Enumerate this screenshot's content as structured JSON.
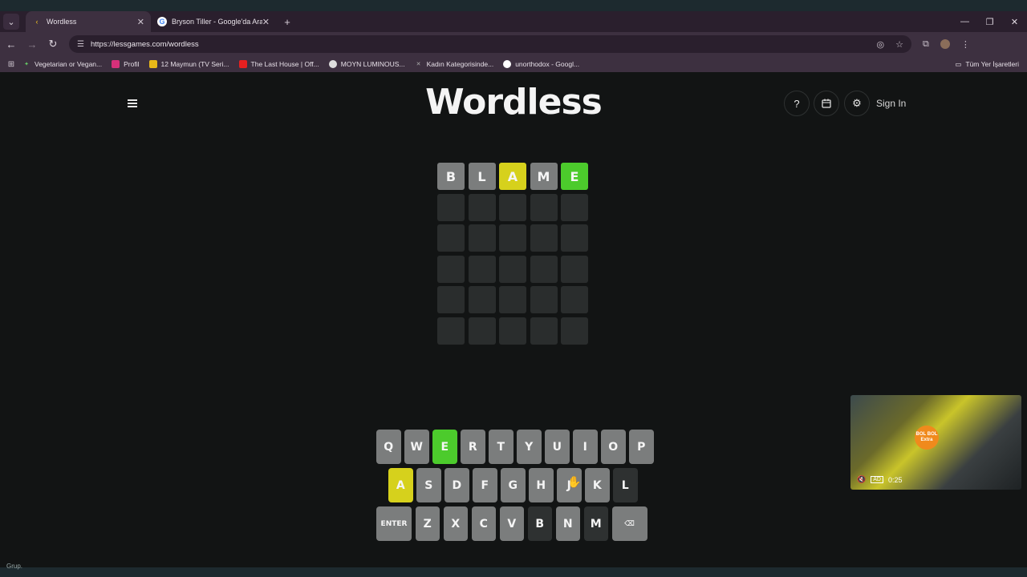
{
  "browser": {
    "tabs": [
      {
        "title": "Wordless",
        "active": true
      },
      {
        "title": "Bryson Tiller - Google'da Ara",
        "active": false
      }
    ],
    "url": "https://lessgames.com/wordless",
    "bookmarks": [
      "Vegetarian or Vegan...",
      "Profil",
      "12 Maymun (TV Seri...",
      "The Last House | Off...",
      "MOYN LUMINOUS...",
      "Kadın Kategorisinde...",
      "unorthodox - Googl..."
    ],
    "bookmarks_folder": "Tüm Yer İşaretleri"
  },
  "app": {
    "logo": "Wordless",
    "help_icon": "?",
    "sign_in": "Sign In"
  },
  "board": {
    "rows": [
      [
        {
          "l": "B",
          "s": "absent"
        },
        {
          "l": "L",
          "s": "absent"
        },
        {
          "l": "A",
          "s": "present"
        },
        {
          "l": "M",
          "s": "absent"
        },
        {
          "l": "E",
          "s": "correct"
        }
      ],
      [
        {
          "l": "",
          "s": "empty"
        },
        {
          "l": "",
          "s": "empty"
        },
        {
          "l": "",
          "s": "empty"
        },
        {
          "l": "",
          "s": "empty"
        },
        {
          "l": "",
          "s": "empty"
        }
      ],
      [
        {
          "l": "",
          "s": "empty"
        },
        {
          "l": "",
          "s": "empty"
        },
        {
          "l": "",
          "s": "empty"
        },
        {
          "l": "",
          "s": "empty"
        },
        {
          "l": "",
          "s": "empty"
        }
      ],
      [
        {
          "l": "",
          "s": "empty"
        },
        {
          "l": "",
          "s": "empty"
        },
        {
          "l": "",
          "s": "empty"
        },
        {
          "l": "",
          "s": "empty"
        },
        {
          "l": "",
          "s": "empty"
        }
      ],
      [
        {
          "l": "",
          "s": "empty"
        },
        {
          "l": "",
          "s": "empty"
        },
        {
          "l": "",
          "s": "empty"
        },
        {
          "l": "",
          "s": "empty"
        },
        {
          "l": "",
          "s": "empty"
        }
      ],
      [
        {
          "l": "",
          "s": "empty"
        },
        {
          "l": "",
          "s": "empty"
        },
        {
          "l": "",
          "s": "empty"
        },
        {
          "l": "",
          "s": "empty"
        },
        {
          "l": "",
          "s": "empty"
        }
      ]
    ]
  },
  "keyboard": {
    "row1": [
      {
        "k": "Q",
        "s": "default"
      },
      {
        "k": "W",
        "s": "default"
      },
      {
        "k": "E",
        "s": "correct"
      },
      {
        "k": "R",
        "s": "default"
      },
      {
        "k": "T",
        "s": "default"
      },
      {
        "k": "Y",
        "s": "default"
      },
      {
        "k": "U",
        "s": "default"
      },
      {
        "k": "I",
        "s": "default"
      },
      {
        "k": "O",
        "s": "default"
      },
      {
        "k": "P",
        "s": "default"
      }
    ],
    "row2": [
      {
        "k": "A",
        "s": "present"
      },
      {
        "k": "S",
        "s": "default"
      },
      {
        "k": "D",
        "s": "default"
      },
      {
        "k": "F",
        "s": "default"
      },
      {
        "k": "G",
        "s": "default"
      },
      {
        "k": "H",
        "s": "default"
      },
      {
        "k": "J",
        "s": "default"
      },
      {
        "k": "K",
        "s": "default"
      },
      {
        "k": "L",
        "s": "absent"
      }
    ],
    "row3": [
      {
        "k": "ENTER",
        "s": "default",
        "wide": true
      },
      {
        "k": "Z",
        "s": "default"
      },
      {
        "k": "X",
        "s": "default"
      },
      {
        "k": "C",
        "s": "default"
      },
      {
        "k": "V",
        "s": "default"
      },
      {
        "k": "B",
        "s": "absent"
      },
      {
        "k": "N",
        "s": "default"
      },
      {
        "k": "M",
        "s": "absent"
      },
      {
        "k": "⌫",
        "s": "default",
        "wide": true
      }
    ]
  },
  "video_ad": {
    "ad_label": "AD",
    "time": "0:25",
    "badge_text": "BOL BOL Extra"
  },
  "status_text": "Grup."
}
